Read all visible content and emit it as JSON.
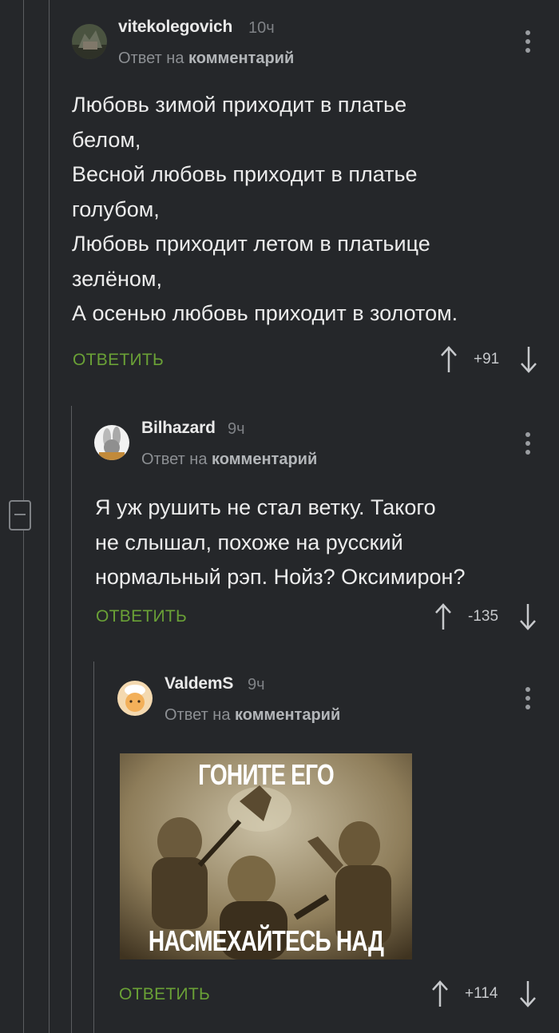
{
  "comments": [
    {
      "username": "vitekolegovich",
      "time": "10ч",
      "reply_prefix": "Ответ на",
      "reply_target": "комментарий",
      "text_lines": [
        "Любовь зимой приходит в платье",
        "белом,",
        "Весной любовь приходит в платье",
        "голубом,",
        "Любовь приходит летом в платьице",
        "зелёном,",
        "А осенью любовь приходит в золотом."
      ],
      "answer_label": "ОТВЕТИТЬ",
      "rating": "+91"
    },
    {
      "username": "Bilhazard",
      "time": "9ч",
      "reply_prefix": "Ответ на",
      "reply_target": "комментарий",
      "text_lines": [
        "Я уж рушить не стал ветку. Такого",
        "не слышал, похоже на русский",
        "нормальный рэп. Нойз? Оксимирон?"
      ],
      "answer_label": "ОТВЕТИТЬ",
      "rating": "-135"
    },
    {
      "username": "ValdemS",
      "time": "9ч",
      "reply_prefix": "Ответ на",
      "reply_target": "комментарий",
      "meme": {
        "top_caption": "ГОНИТЕ ЕГО",
        "bottom_caption": "НАСМЕХАЙТЕСЬ НАД НИМ"
      },
      "answer_label": "ОТВЕТИТЬ",
      "rating": "+114"
    }
  ],
  "colors": {
    "background": "#25272a",
    "accent_green": "#6aa136",
    "thread_line": "#5b5d60"
  },
  "icons": [
    "options-dots-icon",
    "upvote-arrow-icon",
    "downvote-arrow-icon",
    "collapse-minus-icon"
  ]
}
